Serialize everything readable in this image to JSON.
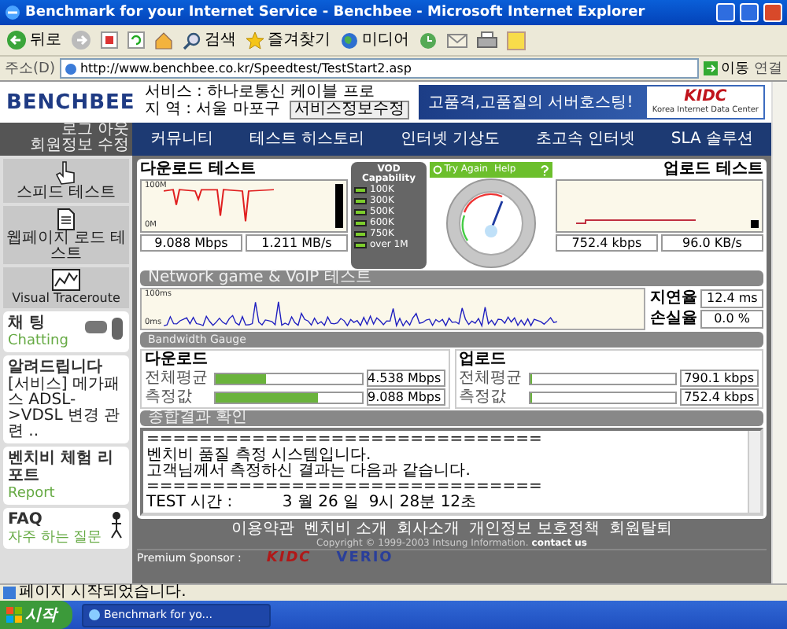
{
  "window": {
    "title": "Benchmark for your Internet Service - Benchbee - Microsoft Internet Explorer"
  },
  "toolbar": {
    "back": "뒤로",
    "items": [
      {
        "kind": "search",
        "label": "검색"
      },
      {
        "kind": "star",
        "label": "즐겨찾기"
      },
      {
        "kind": "globe",
        "label": "미디어"
      }
    ]
  },
  "address_bar": {
    "label": "주소(D)",
    "url": "http://www.benchbee.co.kr/Speedtest/TestStart2.asp",
    "go": "이동",
    "links": "연결"
  },
  "site": {
    "logo": "BENCHBEE",
    "service_info": [
      {
        "label": "서비스 :",
        "value": "하나로통신 케이블 프로"
      },
      {
        "label": "지 역 :",
        "value": "서울 마포구"
      }
    ],
    "edit_button": "서비스정보수정",
    "banner": {
      "text": "고품격,고품질의 서버호스팅!",
      "brand": "KIDC",
      "brand_sub": "Korea Internet Data Center"
    }
  },
  "account_links": [
    "로그 아웃",
    "회원정보 수정"
  ],
  "nav": [
    "커뮤니티",
    "테스트 히스토리",
    "인터넷 기상도",
    "초고속 인터넷",
    "SLA 솔루션"
  ],
  "sidebar": {
    "menu": [
      {
        "kind": "hand",
        "label": "스피드 테스트"
      },
      {
        "kind": "page",
        "label": "웹페이지 로드 테스트"
      },
      {
        "kind": "graph",
        "label": "Visual Traceroute"
      }
    ],
    "chat": {
      "title": "채 팅",
      "subtitle": "Chatting"
    },
    "notice": {
      "title": "알려드립니다",
      "text": "[서비스] 메가패스 ADSL->VDSL 변경 관련 .."
    },
    "report": {
      "title": "벤치비 체험 리포트",
      "subtitle": "Report"
    },
    "faq": {
      "title": "FAQ",
      "subtitle": "자주 하는 질문"
    }
  },
  "download_test": {
    "title": "다운로드 테스트",
    "axis_top": "100M",
    "axis_bottom": "0M",
    "readings": [
      "9.088 Mbps",
      "1.211 MB/s"
    ]
  },
  "vod": {
    "title": "VOD Capability",
    "levels": [
      {
        "label": "100K",
        "on": true
      },
      {
        "label": "300K",
        "on": true
      },
      {
        "label": "500K",
        "on": true
      },
      {
        "label": "600K",
        "on": true
      },
      {
        "label": "750K",
        "on": true
      },
      {
        "label": "over 1M",
        "on": true
      }
    ]
  },
  "speed_gauge": {
    "try_again": "Try Again",
    "help": "Help"
  },
  "upload_test": {
    "title": "업로드 테스트",
    "readings": [
      "752.4 kbps",
      "96.0 KB/s"
    ]
  },
  "network_test": {
    "title": "Network game & VoIP 테스트",
    "axis_top": "100ms",
    "axis_bottom": "0ms",
    "delay_label": "지연율",
    "delay": "12.4 ms",
    "loss_label": "손실율",
    "loss": "0.0 %"
  },
  "bandwidth": {
    "title": "Bandwidth Gauge",
    "groups": [
      {
        "title": "다운로드",
        "rows": [
          {
            "label": "전체평균",
            "level": 0.35,
            "value": "4.538 Mbps"
          },
          {
            "label": "측정값",
            "level": 0.7,
            "value": "9.088 Mbps"
          }
        ]
      },
      {
        "title": "업로드",
        "rows": [
          {
            "label": "전체평균",
            "level": 0.02,
            "value": "790.1 kbps"
          },
          {
            "label": "측정값",
            "level": 0.02,
            "value": "752.4 kbps"
          }
        ]
      }
    ]
  },
  "summary": {
    "title": "종합결과 확인",
    "lines": [
      "==============================",
      "벤치비 품질 측정 시스템입니다.",
      "고객님께서 측정하신 결과는 다음과 같습니다.",
      "==============================",
      "TEST 시간 :          3 월 26 일  9시 28분 12초"
    ]
  },
  "footer": {
    "links": [
      "이용약관",
      "벤치비 소개",
      "회사소개",
      "개인정보 보호정책",
      "회원탈퇴"
    ],
    "copyright": "Copyright © 1999-2003 Intsung Information.",
    "contact": "contact us",
    "sponsor_label": "Premium Sponsor :",
    "sponsors": [
      "KIDC",
      "VERIO"
    ]
  },
  "status_bar": {
    "text": "페이지 시작되었습니다."
  },
  "taskbar": {
    "start": "시작",
    "tasks": [
      {
        "label": "Benchmark for yo...",
        "selected": true
      }
    ]
  }
}
